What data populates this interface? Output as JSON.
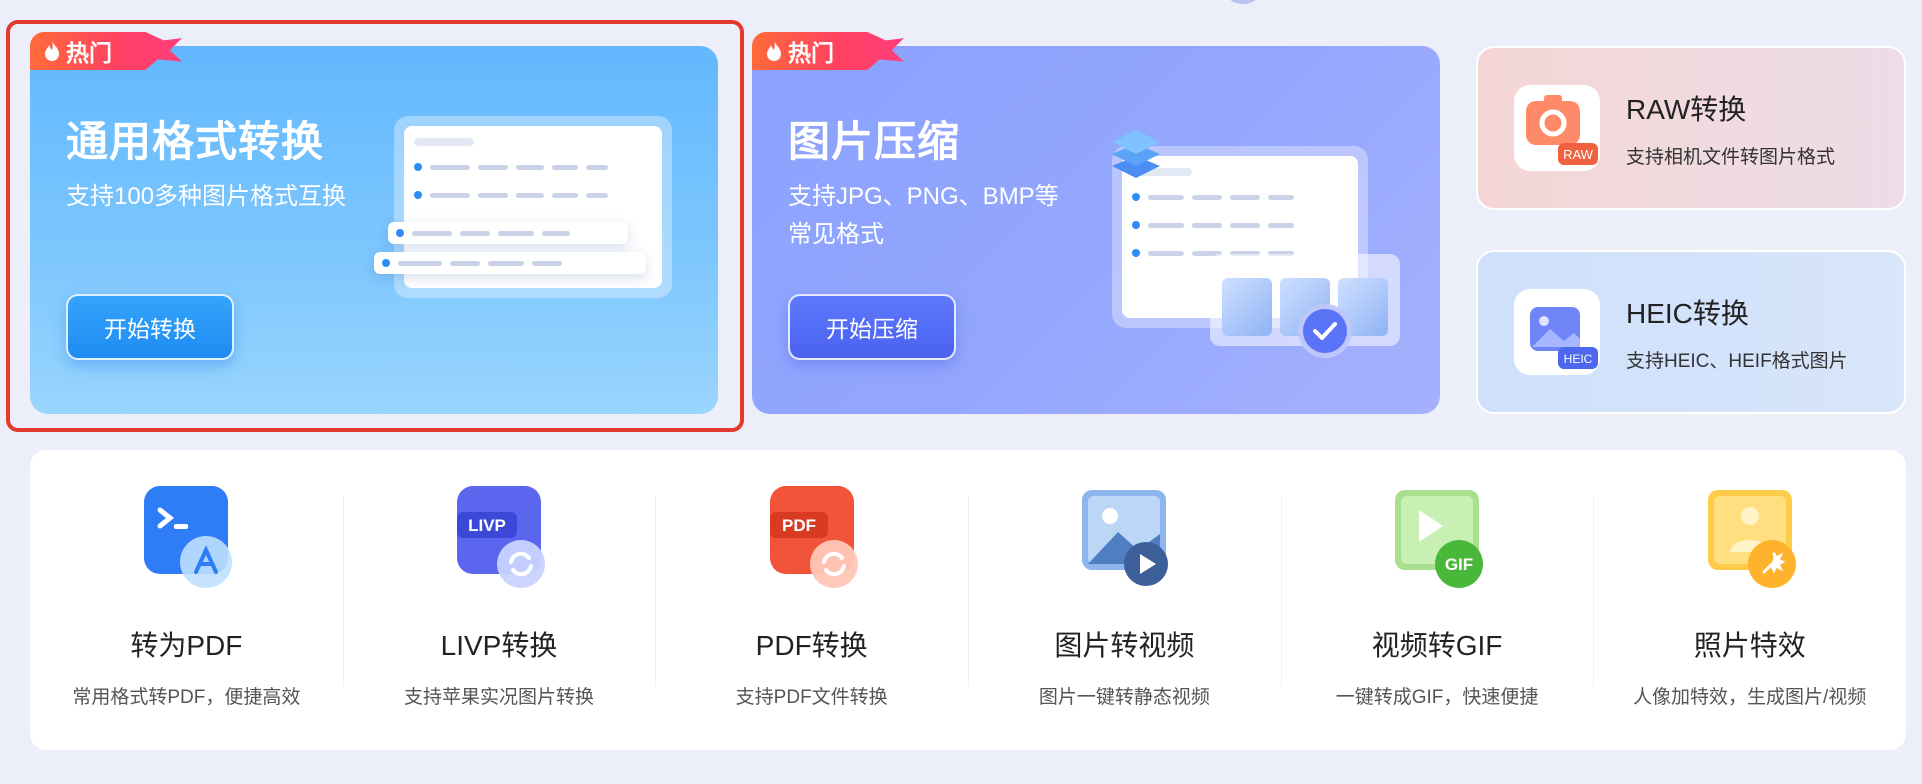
{
  "hero_cards": [
    {
      "badge": "热门",
      "title": "通用格式转换",
      "description": "支持100多种图片格式互换",
      "button": "开始转换"
    },
    {
      "badge": "热门",
      "title": "图片压缩",
      "description": "支持JPG、PNG、BMP等常见格式",
      "button": "开始压缩"
    }
  ],
  "side_cards": [
    {
      "title": "RAW转换",
      "subtitle": "支持相机文件转图片格式",
      "icon": "raw-icon",
      "icon_label": "RAW"
    },
    {
      "title": "HEIC转换",
      "subtitle": "支持HEIC、HEIF格式图片",
      "icon": "heic-icon",
      "icon_label": "HEIC"
    }
  ],
  "tools": [
    {
      "title": "转为PDF",
      "subtitle": "常用格式转PDF，便捷高效",
      "icon": "to-pdf-icon"
    },
    {
      "title": "LIVP转换",
      "subtitle": "支持苹果实况图片转换",
      "icon": "livp-icon",
      "icon_label": "LIVP"
    },
    {
      "title": "PDF转换",
      "subtitle": "支持PDF文件转换",
      "icon": "pdf-icon",
      "icon_label": "PDF"
    },
    {
      "title": "图片转视频",
      "subtitle": "图片一键转静态视频",
      "icon": "image-to-video-icon"
    },
    {
      "title": "视频转GIF",
      "subtitle": "一键转成GIF，快速便捷",
      "icon": "video-to-gif-icon",
      "icon_label": "GIF"
    },
    {
      "title": "照片特效",
      "subtitle": "人像加特效，生成图片/视频",
      "icon": "photo-effects-icon"
    }
  ],
  "colors": {
    "hot_badge": "#ff4a5c",
    "convert_card": "#6cbdfe",
    "compress_card": "#8ea4fe",
    "selection_outline": "#e4392e"
  }
}
